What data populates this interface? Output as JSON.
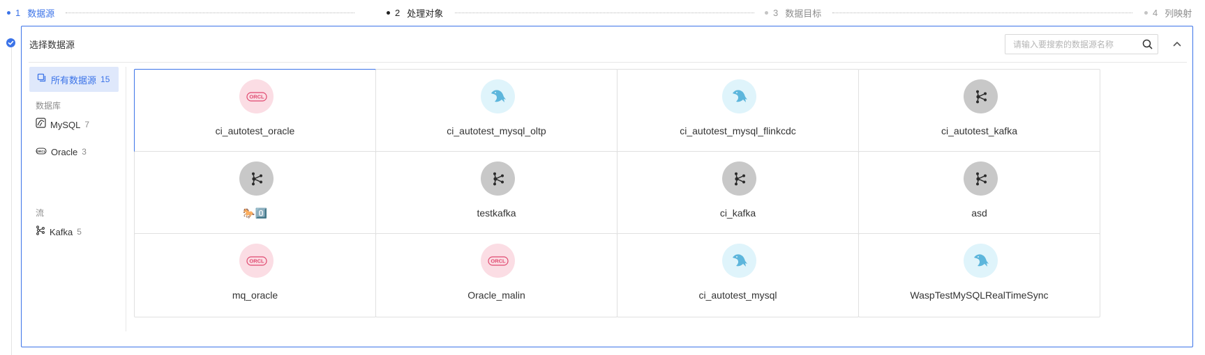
{
  "steps": [
    {
      "num": "1",
      "label": "数据源",
      "state": "active"
    },
    {
      "num": "2",
      "label": "处理对象",
      "state": "current"
    },
    {
      "num": "3",
      "label": "数据目标",
      "state": "pending"
    },
    {
      "num": "4",
      "label": "列映射",
      "state": "pending"
    }
  ],
  "panel": {
    "title": "选择数据源",
    "search_placeholder": "请输入要搜索的数据源名称"
  },
  "sidebar": {
    "all": {
      "label": "所有数据源",
      "count": "15"
    },
    "groups": [
      {
        "title": "数据库",
        "items": [
          {
            "label": "MySQL",
            "count": "7",
            "icon": "mysql-icon"
          },
          {
            "label": "Oracle",
            "count": "3",
            "icon": "oracle-icon"
          }
        ]
      },
      {
        "title": "流",
        "items": [
          {
            "label": "Kafka",
            "count": "5",
            "icon": "kafka-icon"
          }
        ]
      }
    ]
  },
  "sources": [
    {
      "name": "ci_autotest_oracle",
      "type": "oracle",
      "selected": true
    },
    {
      "name": "ci_autotest_mysql_oltp",
      "type": "mysql"
    },
    {
      "name": "ci_autotest_mysql_flinkcdc",
      "type": "mysql"
    },
    {
      "name": "ci_autotest_kafka",
      "type": "kafka"
    },
    {
      "name": "🐎0️⃣",
      "type": "kafka"
    },
    {
      "name": "testkafka",
      "type": "kafka"
    },
    {
      "name": "ci_kafka",
      "type": "kafka"
    },
    {
      "name": "asd",
      "type": "kafka"
    },
    {
      "name": "mq_oracle",
      "type": "oracle"
    },
    {
      "name": "Oracle_malin",
      "type": "oracle"
    },
    {
      "name": "ci_autotest_mysql",
      "type": "mysql"
    },
    {
      "name": "WaspTestMySQLRealTimeSync",
      "type": "mysql"
    }
  ],
  "colors": {
    "accent": "#3b73e8",
    "oracle_bg": "#fbdde4",
    "oracle_fg": "#e0496f",
    "mysql_bg": "#dff4fb",
    "mysql_fg": "#5db6dc",
    "kafka_bg": "#c8c8c8",
    "kafka_fg": "#2b2b2b"
  }
}
